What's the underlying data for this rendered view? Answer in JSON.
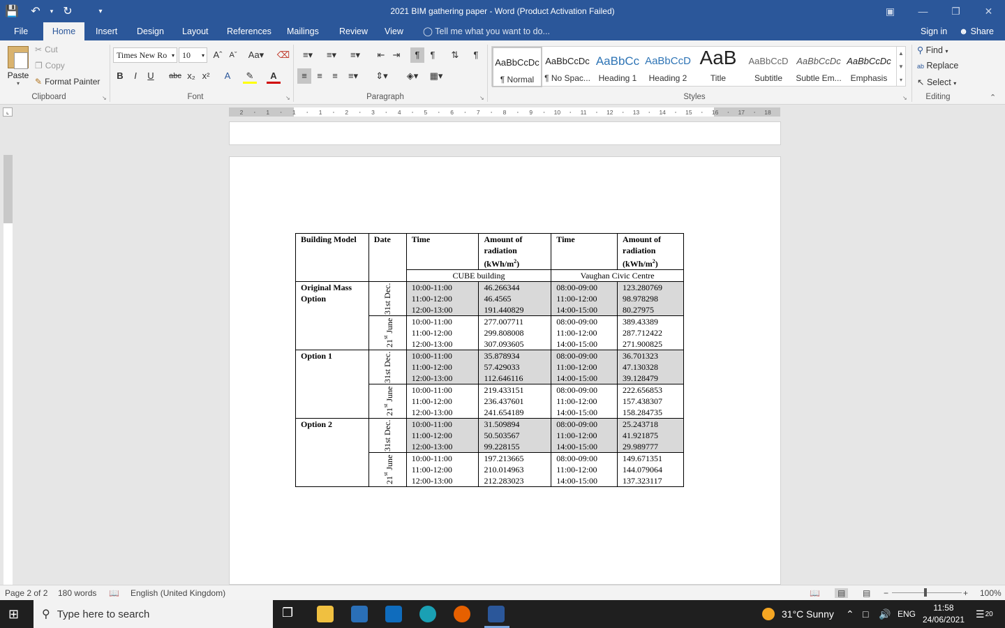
{
  "window": {
    "title": "2021 BIM gathering paper - Word (Product Activation Failed)",
    "qat": {
      "save_icon": "save-icon",
      "undo_icon": "undo-icon",
      "redo_icon": "repeat-icon",
      "customize_icon": "customize-icon"
    }
  },
  "tabs": [
    "File",
    "Home",
    "Insert",
    "Design",
    "Layout",
    "References",
    "Mailings",
    "Review",
    "View"
  ],
  "active_tab": "Home",
  "tell_me": "Tell me what you want to do...",
  "sign_in": "Sign in",
  "share": "Share",
  "ribbon": {
    "clipboard": {
      "paste": "Paste",
      "cut": "Cut",
      "copy": "Copy",
      "format_painter": "Format Painter",
      "label": "Clipboard"
    },
    "font": {
      "name": "Times New Ro",
      "size": "10",
      "label": "Font",
      "bold": "B",
      "italic": "I",
      "underline": "U",
      "strike": "abc",
      "subscript": "x₂",
      "superscript": "x²"
    },
    "paragraph": {
      "label": "Paragraph"
    },
    "styles": {
      "label": "Styles",
      "items": [
        {
          "preview": "AaBbCcDc",
          "name": "¶ Normal"
        },
        {
          "preview": "AaBbCcDc",
          "name": "¶ No Spac..."
        },
        {
          "preview": "AaBbCc",
          "name": "Heading 1"
        },
        {
          "preview": "AaBbCcD",
          "name": "Heading 2"
        },
        {
          "preview": "AaB",
          "name": "Title"
        },
        {
          "preview": "AaBbCcD",
          "name": "Subtitle"
        },
        {
          "preview": "AaBbCcDc",
          "name": "Subtle Em..."
        },
        {
          "preview": "AaBbCcDc",
          "name": "Emphasis"
        }
      ]
    },
    "editing": {
      "find": "Find",
      "replace": "Replace",
      "select": "Select",
      "label": "Editing"
    }
  },
  "ruler": {
    "h_labels": [
      "2",
      "1",
      "1",
      "1",
      "2",
      "3",
      "4",
      "5",
      "6",
      "7",
      "8",
      "9",
      "10",
      "11",
      "12",
      "13",
      "14",
      "15",
      "16",
      "17",
      "18"
    ]
  },
  "table": {
    "headers": {
      "building_model": "Building Model",
      "date": "Date",
      "time": "Time",
      "radiation_a": "Amount of",
      "radiation_b": "radiation",
      "radiation_unit": "(kWh/m",
      "radiation_sup": "2",
      "radiation_close": ")"
    },
    "group_cube": "CUBE building",
    "group_vaughan": "Vaughan Civic Centre",
    "dec_label": "31st Dec.",
    "june_num": "21",
    "june_sup": "st",
    "june_word": "June",
    "models": [
      {
        "name": "Original Mass Option",
        "dec": {
          "times_a": [
            "10:00-11:00",
            "11:00-12:00",
            "12:00-13:00"
          ],
          "rad_a": [
            "46.266344",
            "46.4565",
            "191.440829"
          ],
          "times_b": [
            "08:00-09:00",
            "11:00-12:00",
            "14:00-15:00"
          ],
          "rad_b": [
            "123.280769",
            "98.978298",
            "80.27975"
          ]
        },
        "june": {
          "times_a": [
            "10:00-11:00",
            "11:00-12:00",
            "12:00-13:00"
          ],
          "rad_a": [
            "277.007711",
            "299.808008",
            "307.093605"
          ],
          "times_b": [
            "08:00-09:00",
            "11:00-12:00",
            "14:00-15:00"
          ],
          "rad_b": [
            "389.43389",
            "287.712422",
            "271.900825"
          ]
        }
      },
      {
        "name": "Option 1",
        "dec": {
          "times_a": [
            "10:00-11:00",
            "11:00-12:00",
            "12:00-13:00"
          ],
          "rad_a": [
            "35.878934",
            "57.429033",
            "112.646116"
          ],
          "times_b": [
            "08:00-09:00",
            "11:00-12:00",
            "14:00-15:00"
          ],
          "rad_b": [
            "36.701323",
            "47.130328",
            "39.128479"
          ]
        },
        "june": {
          "times_a": [
            "10:00-11:00",
            "11:00-12:00",
            "12:00-13:00"
          ],
          "rad_a": [
            "219.433151",
            "236.437601",
            "241.654189"
          ],
          "times_b": [
            "08:00-09:00",
            "11:00-12:00",
            "14:00-15:00"
          ],
          "rad_b": [
            "222.656853",
            "157.438307",
            "158.284735"
          ]
        }
      },
      {
        "name": "Option 2",
        "dec": {
          "times_a": [
            "10:00-11:00",
            "11:00-12:00",
            "12:00-13:00"
          ],
          "rad_a": [
            "31.509894",
            "50.503567",
            "99.228155"
          ],
          "times_b": [
            "08:00-09:00",
            "11:00-12:00",
            "14:00-15:00"
          ],
          "rad_b": [
            "25.243718",
            "41.921875",
            "29.989777"
          ]
        },
        "june": {
          "times_a": [
            "10:00-11:00",
            "11:00-12:00",
            "12:00-13:00"
          ],
          "rad_a": [
            "197.213665",
            "210.014963",
            "212.283023"
          ],
          "times_b": [
            "08:00-09:00",
            "11:00-12:00",
            "14:00-15:00"
          ],
          "rad_b": [
            "149.671351",
            "144.079064",
            "137.323117"
          ]
        }
      }
    ]
  },
  "status": {
    "page": "Page 2 of 2",
    "words": "180 words",
    "language": "English (United Kingdom)",
    "zoom": "100%"
  },
  "taskbar": {
    "search_placeholder": "Type here to search",
    "weather": "31°C  Sunny",
    "lang": "ENG",
    "time": "11:58",
    "date": "24/06/2021",
    "notifications": "20"
  },
  "colors": {
    "word_blue": "#2b579a",
    "shade": "#d9d9d9"
  }
}
